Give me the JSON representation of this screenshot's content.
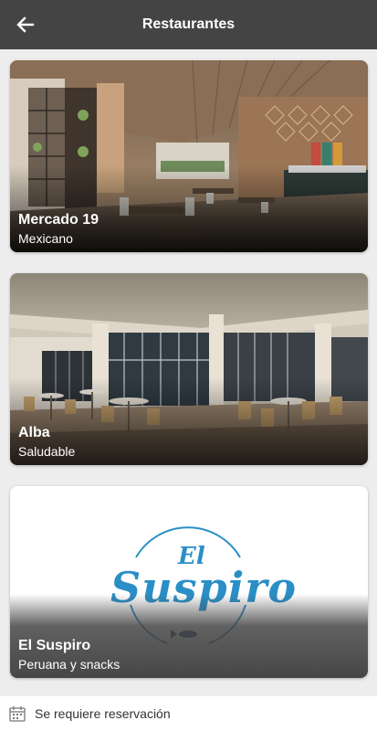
{
  "header": {
    "title": "Restaurantes",
    "back_icon": "arrow-left-icon"
  },
  "restaurants": [
    {
      "name": "Mercado 19",
      "type": "Mexicano"
    },
    {
      "name": "Alba",
      "type": "Saludable"
    },
    {
      "name": "El Suspiro",
      "type": "Peruana y snacks",
      "logo_line1": "El",
      "logo_line2": "Suspiro"
    }
  ],
  "footer": {
    "note": "Se requiere reservación",
    "icon": "calendar-icon"
  },
  "colors": {
    "appbar": "#444444",
    "background": "#ededed",
    "logo_blue": "#2a8fc6"
  }
}
